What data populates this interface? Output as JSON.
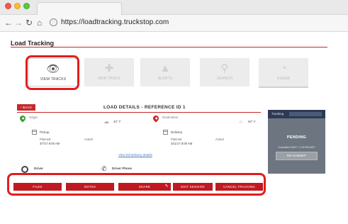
{
  "browser": {
    "url": "https://loadtracking.truckstop.com",
    "back_icon": "arrow-left-icon",
    "forward_icon": "arrow-right-icon",
    "reload_icon": "reload-icon",
    "home_icon": "home-icon",
    "site_icon": "globe-icon"
  },
  "page": {
    "title": "Load Tracking",
    "accent_color": "#c62828",
    "highlight_color": "#e11d1d"
  },
  "nav_tiles": [
    {
      "label": "VIEW TRACKS",
      "icon": "eye-icon",
      "active": true
    },
    {
      "label": "NEW TRACK",
      "icon": "plus-icon",
      "active": false
    },
    {
      "label": "ALERTS",
      "icon": "warning-icon",
      "active": false
    },
    {
      "label": "SEARCH",
      "icon": "search-icon",
      "active": false
    },
    {
      "label": "USAGE",
      "icon": "gauge-icon",
      "active": false
    }
  ],
  "details": {
    "back_label": "‹ BACK",
    "heading": "LOAD DETAILS - REFERENCE ID 1",
    "origin": {
      "label": "Origin",
      "temp": "40° F",
      "section": "Pickup",
      "planned_label": "Planned",
      "planned_value": "3/7/17 8:00 AM",
      "actual_label": "Actual"
    },
    "destination": {
      "label": "Destination",
      "temp": "50° F",
      "section": "Delivery",
      "planned_label": "Planned",
      "planned_value": "3/11/17 8:00 AM",
      "actual_label": "Actual"
    },
    "view_link": "View full delivery details",
    "driver_label": "Driver",
    "driver_phone_label": "Driver Phone"
  },
  "status_panel": {
    "tracking_label": "Tracking",
    "state": "PENDING",
    "submitted": "Submitted 3/9/17 / 2:25 PM MST",
    "resubmit_label": "RE-SUBMIT"
  },
  "actions": [
    {
      "label": "FILES"
    },
    {
      "label": "NOTES"
    },
    {
      "label": "SHARE"
    },
    {
      "label": "EDIT SESSION"
    },
    {
      "label": "CANCEL TRACKING"
    }
  ]
}
